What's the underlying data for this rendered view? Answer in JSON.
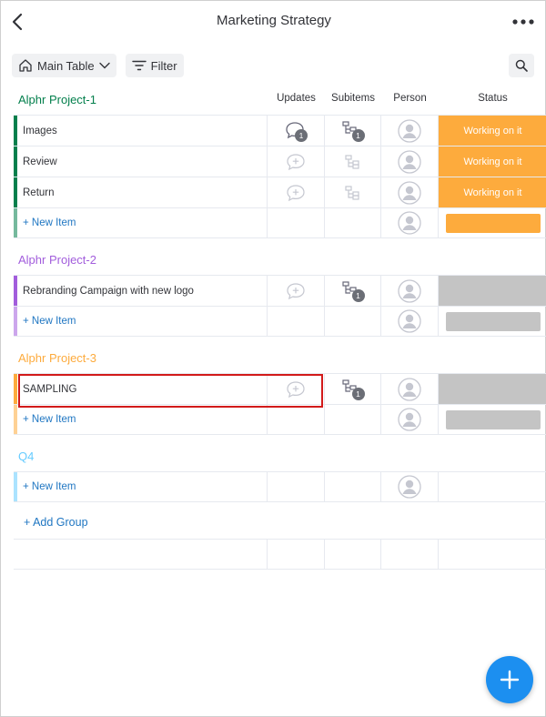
{
  "header": {
    "title": "Marketing Strategy"
  },
  "toolbar": {
    "main_table_label": "Main Table",
    "filter_label": "Filter"
  },
  "columns": {
    "updates": "Updates",
    "subitems": "Subitems",
    "person": "Person",
    "status": "Status"
  },
  "groups": [
    {
      "title": "Alphr Project-1",
      "color": "#037f4c",
      "items": [
        {
          "name": "Images",
          "updates_count": "1",
          "subitems_count": "1",
          "status": "Working on it"
        },
        {
          "name": "Review",
          "updates_count": "",
          "subitems_count": "",
          "status": "Working on it"
        },
        {
          "name": "Return",
          "updates_count": "",
          "subitems_count": "",
          "status": "Working on it"
        }
      ],
      "new_item_label": "+ New Item"
    },
    {
      "title": "Alphr Project-2",
      "color": "#a25ddc",
      "items": [
        {
          "name": "Rebranding Campaign with new logo",
          "updates_count": "",
          "subitems_count": "1",
          "status": ""
        }
      ],
      "new_item_label": "+ New Item"
    },
    {
      "title": "Alphr Project-3",
      "color": "#fdab3d",
      "items": [
        {
          "name": "SAMPLING",
          "updates_count": "",
          "subitems_count": "1",
          "status": ""
        }
      ],
      "new_item_label": "+ New Item"
    },
    {
      "title": "Q4",
      "color": "#66ccff",
      "items": [],
      "new_item_label": "+ New Item"
    }
  ],
  "add_group_label": "+ Add Group",
  "colors": {
    "status_working": "#fdab3d",
    "status_empty": "#c4c4c4",
    "accent": "#1c8ff0",
    "link": "#1f76c2"
  },
  "icons": {
    "back": "chevron-left-icon",
    "more": "more-dots-icon",
    "home": "home-icon",
    "filter": "filter-icon",
    "search": "search-icon",
    "updates": "speech-bubble-icon",
    "subitems": "subitems-icon",
    "person": "person-avatar-icon",
    "fab": "plus-icon"
  }
}
